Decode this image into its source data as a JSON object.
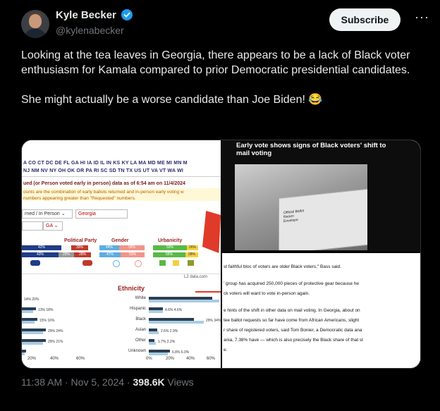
{
  "author": {
    "name": "Kyle Becker",
    "handle": "@kylenabecker",
    "verified": true,
    "avatar_icon": "profile-photo"
  },
  "subscribe_label": "Subscribe",
  "more_label": "···",
  "tweet": {
    "text": "Looking at the tea leaves in Georgia, there appears to be a lack of Black voter enthusiasm for Kamala compared to prior Democratic presidential candidates.\n\nShe might actually be a worse candidate than Joe Biden! 😂"
  },
  "media": {
    "left": {
      "states_row1": "A  CO  CT  DC  DE  FL  GA  HI  IA  ID  IL  IN  KS  KY  LA  MA  MD  ME  MI  MN  M",
      "states_row2": "  NJ  NM  NV  NY  OH  OK  OR  PA  RI  SC  SD  TN  TX  US  UT  VA  VT  WA  WI",
      "heading": "ued (or Person voted early in person) data as of 6:54 am on 11/4/2024",
      "note1": "ounts are the combination of early ballots returned and in-person early voting w",
      "note2": "numbers appearing greater than \"Requested\" numbers.",
      "select1": "rned / In Person ⌄",
      "select2": "Georgia",
      "select3": "GA ⌄",
      "political_party": "Political Party",
      "gender": "Gender",
      "urbanicity": "Urbanicity",
      "party_row1": [
        "42%",
        "39%"
      ],
      "party_row2": [
        "43%",
        "29%",
        "28%"
      ],
      "gender_row1": [
        "44%",
        "56%"
      ],
      "gender_row2": [
        "47%",
        "53%"
      ],
      "urban_row1": [
        "59%",
        "26%"
      ],
      "urban_row2": [
        "56%",
        "28%"
      ],
      "ethnicity": "Ethnicity",
      "eth_labels": [
        "White",
        "Hispanic",
        "Black",
        "Asian",
        "Other",
        "Unknown"
      ],
      "eth_values": [
        "",
        "4.6%  4.6%",
        "29%  34%",
        "2.6%  2.9%",
        "1.7%  2.2%",
        "6.8%  6.0%"
      ],
      "left_values": [
        "14%  20%",
        "13%  18%",
        "15%  16%",
        "29%  24%",
        "29%  21%",
        ""
      ],
      "axis_left": [
        "20%",
        "40%",
        "60%"
      ],
      "axis_right": [
        "0%",
        "20%",
        "40%",
        "60%"
      ],
      "source_label": "L2 data.com"
    },
    "article": {
      "headline": "Early vote shows signs of Black voters' shift to mail voting",
      "envelope_text": "Official Ballot\nReturn\nEnvelope",
      "lines": [
        "st faithful bloc of voters are older Black voters,\" Bass said.",
        "",
        "' group has acquired 250,000 pieces of protective gear because he",
        "ck voters will want to vote in-person again.",
        "",
        "e hints of the shift in other data on mail voting. In Georgia, about on",
        "tee ballot requests so far have come from African Americans, slight",
        "r share of registered voters, said Tom Bonier, a Democratic data ana",
        "ania, 7.38% have — which is also precisely the Black share of that st",
        "e."
      ]
    }
  },
  "meta": {
    "time": "11:38 AM · Nov 5, 2024 · ",
    "views_count": "398.6K",
    "views_label": " Views"
  },
  "colors": {
    "dem_blue": "#1f3c88",
    "rep_red": "#c0392b",
    "subscribe_bg": "#eff3f4",
    "verified_blue": "#1d9bf0"
  }
}
